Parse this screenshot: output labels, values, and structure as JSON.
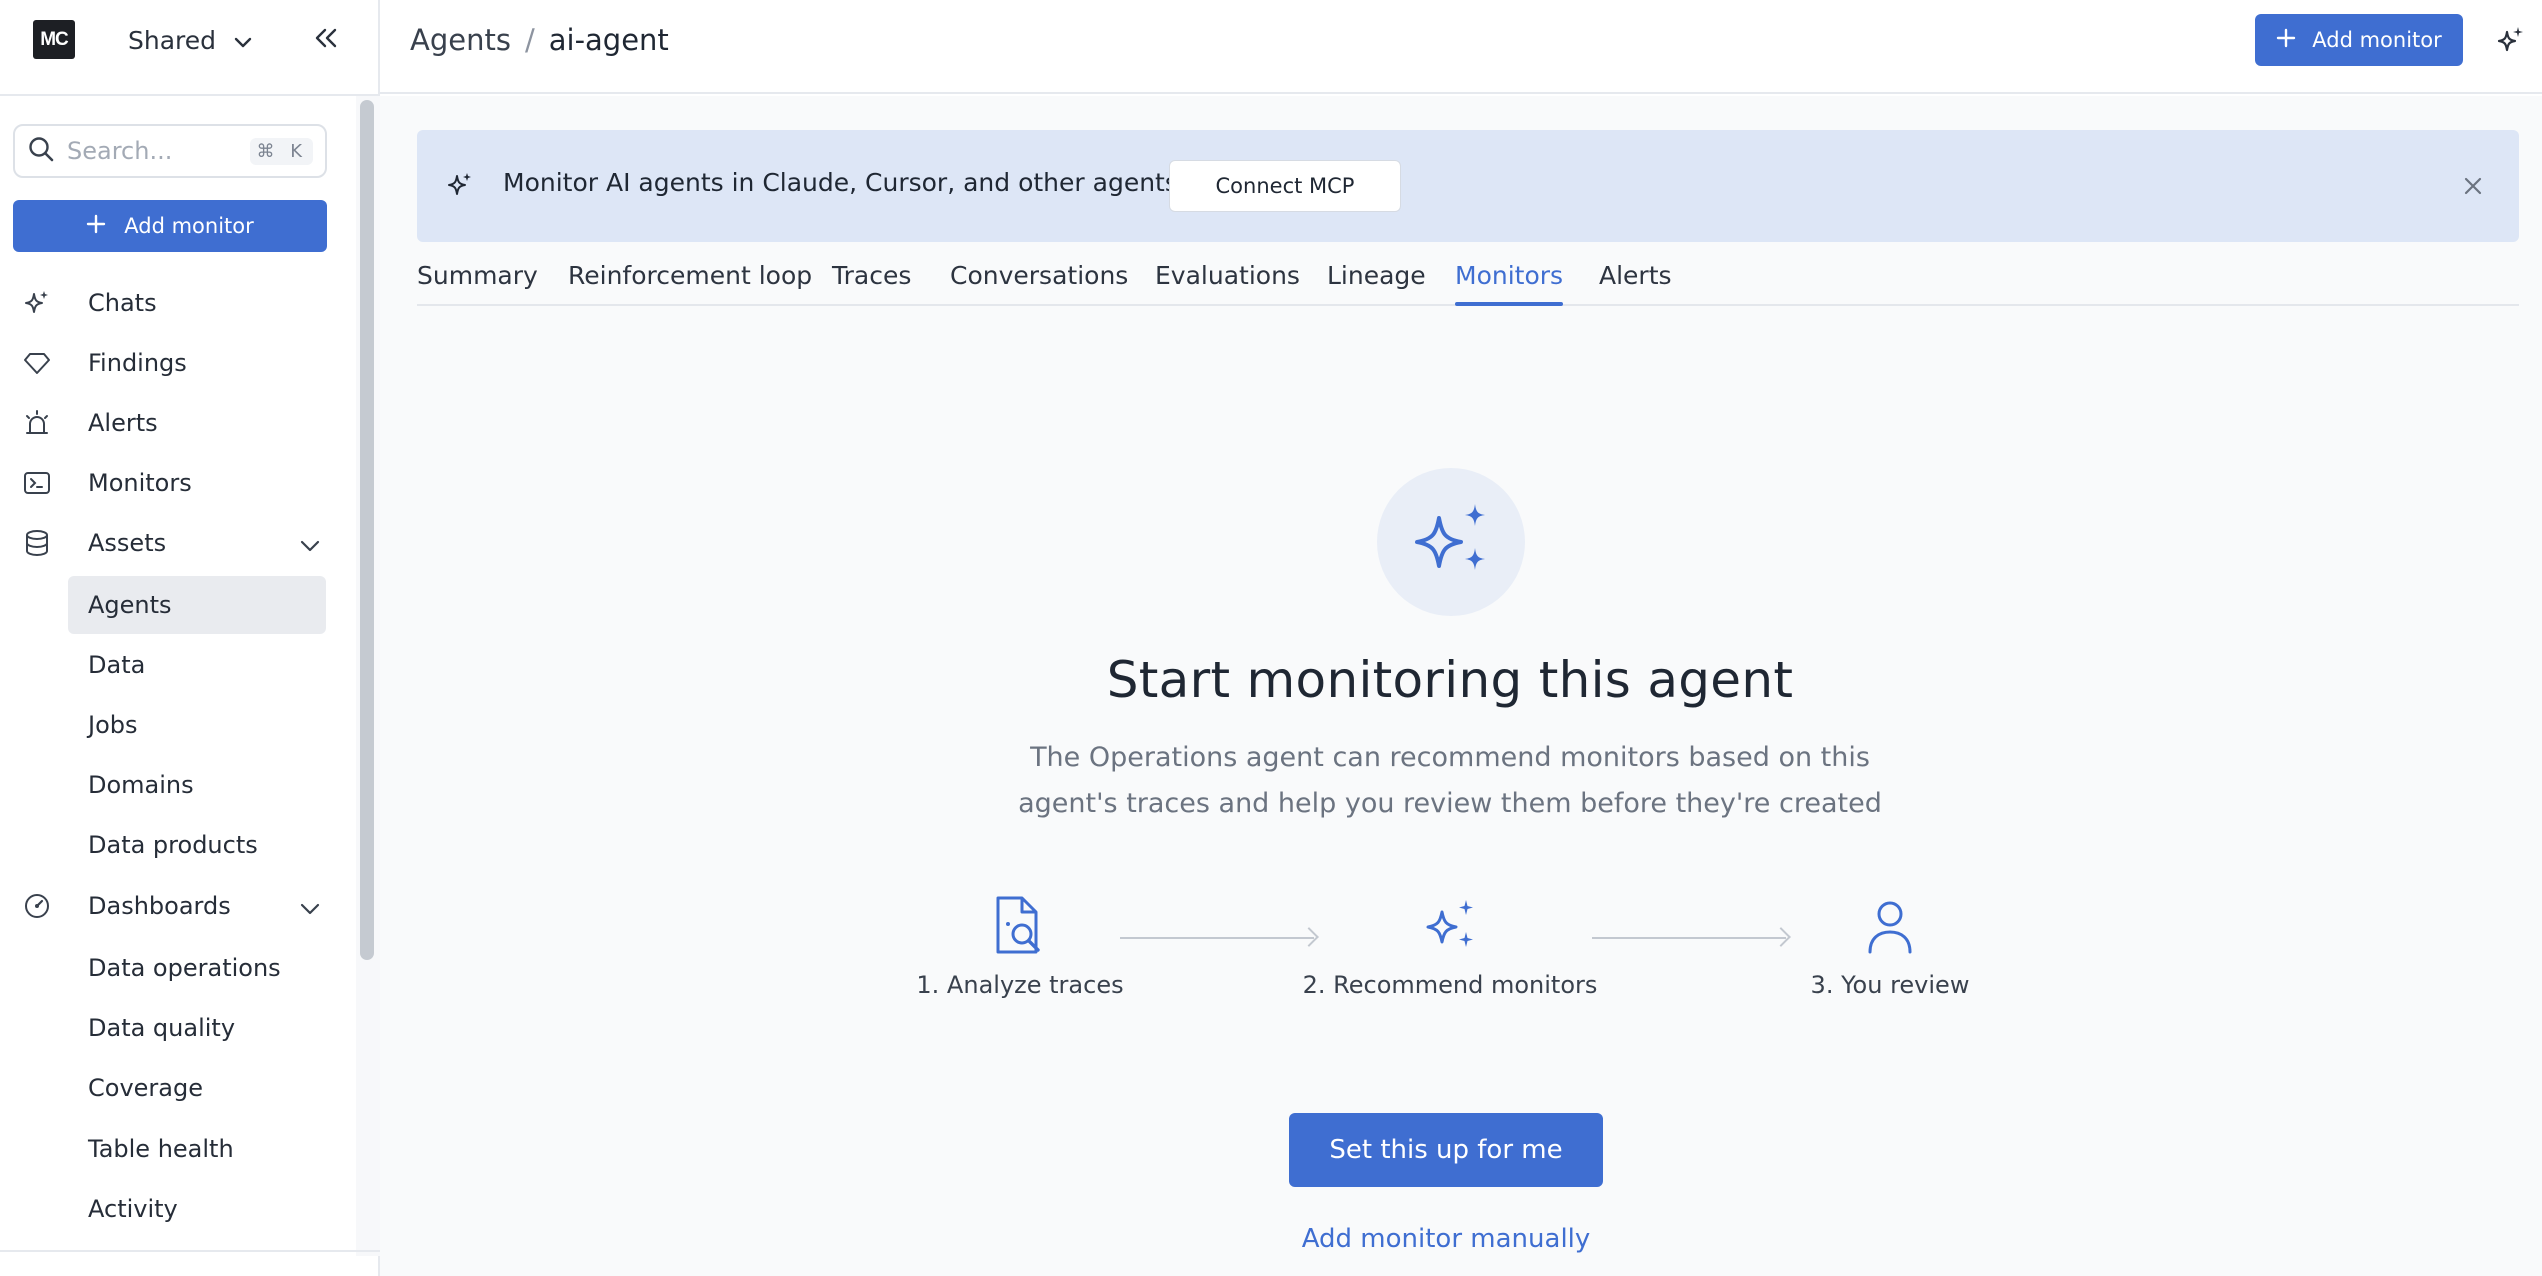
{
  "workspace": {
    "logo": "MC",
    "name": "Shared"
  },
  "sidebar": {
    "search_placeholder": "Search...",
    "search_shortcut": "⌘ K",
    "add_button": "Add monitor",
    "items": [
      {
        "label": "Chats",
        "icon": "sparkle-icon"
      },
      {
        "label": "Findings",
        "icon": "diamond-icon"
      },
      {
        "label": "Alerts",
        "icon": "siren-icon"
      },
      {
        "label": "Monitors",
        "icon": "terminal-icon"
      },
      {
        "label": "Assets",
        "icon": "database-icon",
        "expanded": true
      },
      {
        "label": "Dashboards",
        "icon": "gauge-icon",
        "expanded": true
      }
    ],
    "assets_children": [
      "Agents",
      "Data",
      "Jobs",
      "Domains",
      "Data products"
    ],
    "dashboards_children": [
      "Data operations",
      "Data quality",
      "Coverage",
      "Table health",
      "Activity"
    ],
    "active_item": "Agents"
  },
  "header": {
    "breadcrumb_parent": "Agents",
    "breadcrumb_separator": "/",
    "breadcrumb_current": "ai-agent",
    "add_button": "Add monitor"
  },
  "banner": {
    "text": "Monitor AI agents in Claude, Cursor, and other agents",
    "button": "Connect MCP"
  },
  "tabs": [
    "Summary",
    "Reinforcement loop",
    "Traces",
    "Conversations",
    "Evaluations",
    "Lineage",
    "Monitors",
    "Alerts"
  ],
  "active_tab": "Monitors",
  "empty_state": {
    "title": "Start monitoring this agent",
    "subtitle_line1": "The Operations agent can recommend monitors based on this",
    "subtitle_line2": "agent's traces and help you review them before they're created",
    "steps": [
      {
        "label": "1. Analyze traces",
        "icon": "document-search-icon"
      },
      {
        "label": "2. Recommend monitors",
        "icon": "sparkles-icon"
      },
      {
        "label": "3. You review",
        "icon": "user-icon"
      }
    ],
    "primary_button": "Set this up for me",
    "secondary_link": "Add monitor manually"
  },
  "colors": {
    "accent": "#3f6ed1",
    "banner_bg": "#dde6f6",
    "text": "#1f2733",
    "muted": "#6b7380"
  }
}
